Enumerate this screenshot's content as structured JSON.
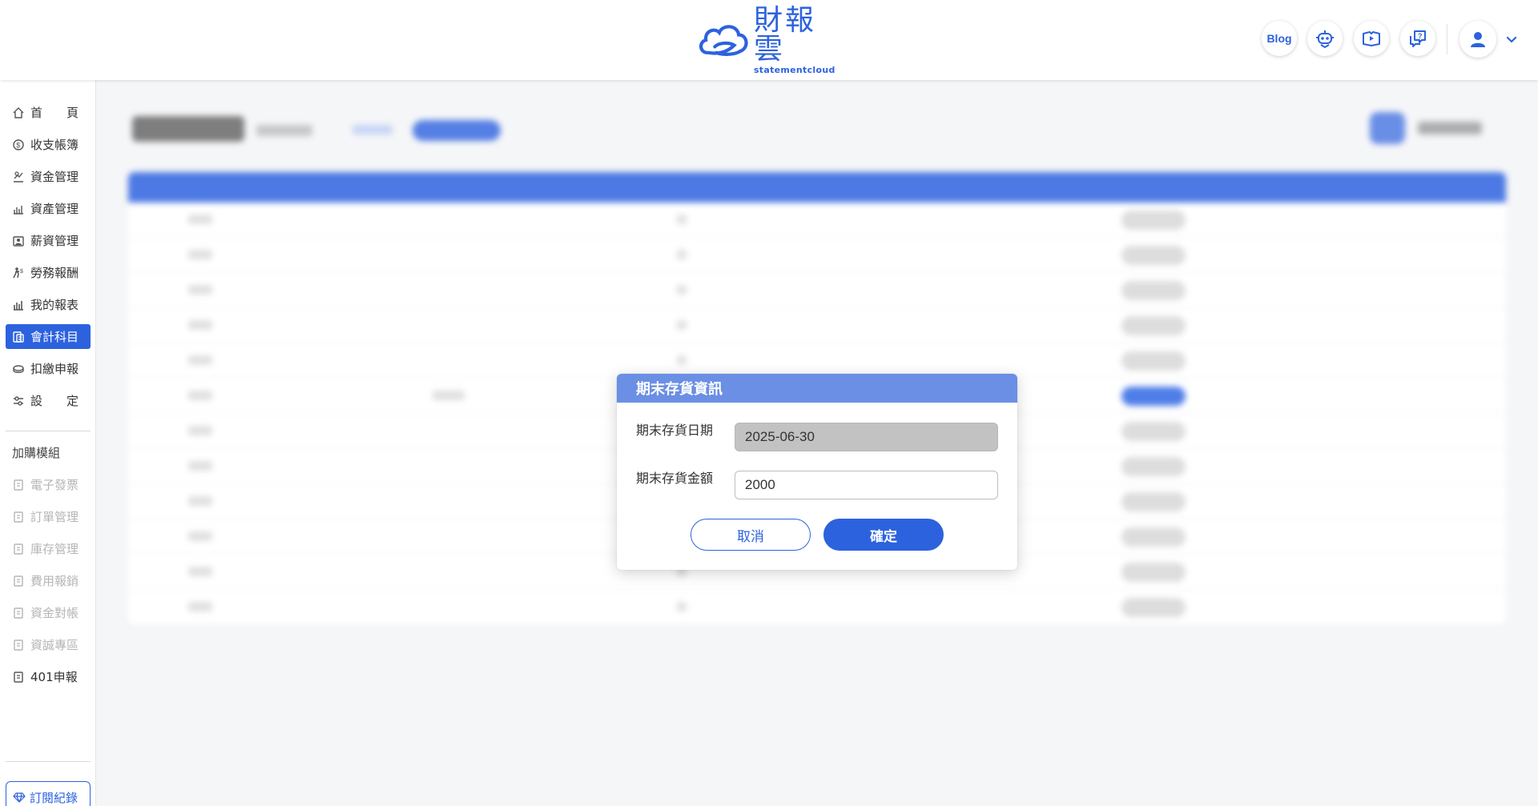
{
  "header": {
    "logo_cn": "財報雲",
    "logo_en": "statementcloud",
    "blog_label": "Blog",
    "icons": [
      "robot-assistant-icon",
      "video-tutorial-icon",
      "help-chat-icon",
      "user-avatar-icon",
      "chevron-down-icon"
    ]
  },
  "sidebar": {
    "items": [
      {
        "label": "首　　頁",
        "icon": "home-icon"
      },
      {
        "label": "收支帳簿",
        "icon": "ledger-icon"
      },
      {
        "label": "資金管理",
        "icon": "funds-icon"
      },
      {
        "label": "資產管理",
        "icon": "assets-icon"
      },
      {
        "label": "薪資管理",
        "icon": "payroll-icon"
      },
      {
        "label": "勞務報酬",
        "icon": "labor-icon"
      },
      {
        "label": "我的報表",
        "icon": "report-icon"
      },
      {
        "label": "會計科目",
        "icon": "accounts-icon",
        "active": true
      },
      {
        "label": "扣繳申報",
        "icon": "withholding-icon"
      },
      {
        "label": "設　　定",
        "icon": "settings-icon"
      }
    ],
    "addon_heading": "加購模組",
    "addons": [
      {
        "label": "電子發票",
        "disabled": true
      },
      {
        "label": "訂單管理",
        "disabled": true
      },
      {
        "label": "庫存管理",
        "disabled": true
      },
      {
        "label": "費用報銷",
        "disabled": true
      },
      {
        "label": "資金對帳",
        "disabled": true
      },
      {
        "label": "資誠專區",
        "disabled": true
      },
      {
        "label": "401申報",
        "disabled": false
      }
    ],
    "subscription_label": "訂閱紀錄"
  },
  "dialog": {
    "title": "期末存貨資訊",
    "date_label": "期末存貨日期",
    "date_value": "2025-06-30",
    "amount_label": "期末存貨金額",
    "amount_value": "2000",
    "cancel_label": "取消",
    "confirm_label": "確定"
  },
  "colors": {
    "brand": "#2d62de",
    "dialog_header": "#6a8fe4"
  }
}
